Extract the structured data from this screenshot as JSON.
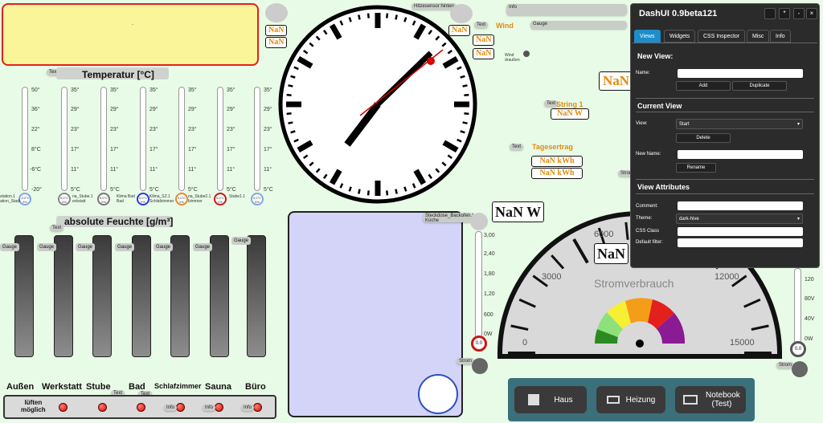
{
  "top_left": {
    "dot": "-"
  },
  "labels": {
    "text": "Text",
    "gauge": "Gauge",
    "info": "Info",
    "strom": "Strom"
  },
  "nan": {
    "val": "NaN",
    "w": "NaN W",
    "kwh": "NaN kWh"
  },
  "temperature": {
    "title": "Temperatur [°C]",
    "scale_a": [
      "50°",
      "36°",
      "22°",
      "8°C",
      "-6°C",
      "-20°"
    ],
    "scale_b": [
      "35°",
      "29°",
      "23°",
      "17°",
      "11°",
      "5°C"
    ],
    "bulb_text": [
      "-0,0°C 0%",
      "0,0°C 0%",
      "0,0°C 0%",
      "0,0°C 0%",
      "0,0°C 0%",
      "0,0°C 0%",
      "0,0°C 0%"
    ],
    "captions": [
      "station.1 ation_Stadt",
      "na_Stube.1 erkstatt",
      "Klima Bad Bad",
      "Klima_SZ.1 Schlafzimmer",
      "na_Stube2.1 fzimmer",
      "Stube1.1",
      "Stube"
    ]
  },
  "humidity": {
    "title": "absolute Feuchte [g/m³]"
  },
  "rooms": [
    "Außen",
    "Werkstatt",
    "Stube",
    "Bad",
    "Schlafzimmer",
    "Sauna",
    "Büro"
  ],
  "ventilate": "lüften\nmöglich",
  "wind": {
    "title": "Wind",
    "subtitle": "Wind draußen"
  },
  "hitze": "Hitzesensor hinten",
  "string1": "String 1",
  "tagesertrag": "Tagesertrag",
  "steckdose": "Steckdose_Backofen.1 Küche",
  "power_scale": [
    "3,00",
    "2,40",
    "1,80",
    "1,20",
    "600",
    "0W"
  ],
  "power_value": "0.0",
  "right_scale": [
    "120",
    "80V",
    "40V",
    "0W"
  ],
  "right_value": "0.0",
  "meter": {
    "label": "Stromverbrauch",
    "ticks": [
      "0",
      "3000",
      "6000",
      "12000",
      "15000"
    ]
  },
  "nav": [
    {
      "label": "Haus",
      "icon": "house-icon"
    },
    {
      "label": "Heizung",
      "icon": "heater-icon"
    },
    {
      "label": "Notebook (Test)",
      "icon": "monitor-icon"
    }
  ],
  "dashui": {
    "title": "DashUI 0.9beta121",
    "controls": [
      "*",
      "-",
      "×"
    ],
    "tabs": [
      "Views",
      "Widgets",
      "CSS Inspector",
      "Misc",
      "Info"
    ],
    "new_view": "New View:",
    "name_label": "Name:",
    "add": "Add",
    "duplicate": "Duplicate",
    "current_view": "Current View",
    "view_label": "View:",
    "view_value": "Start",
    "delete": "Delete",
    "new_name_label": "New Name:",
    "rename": "Rename",
    "view_attrs": "View Attributes",
    "comment_label": "Comment:",
    "theme_label": "Theme:",
    "theme_value": "dark-hive",
    "css_class_label": "CSS Class",
    "default_filter_label": "Default filter:"
  },
  "colors": {
    "accent_orange": "#e28a10",
    "tab_active": "#1e8dc9"
  }
}
